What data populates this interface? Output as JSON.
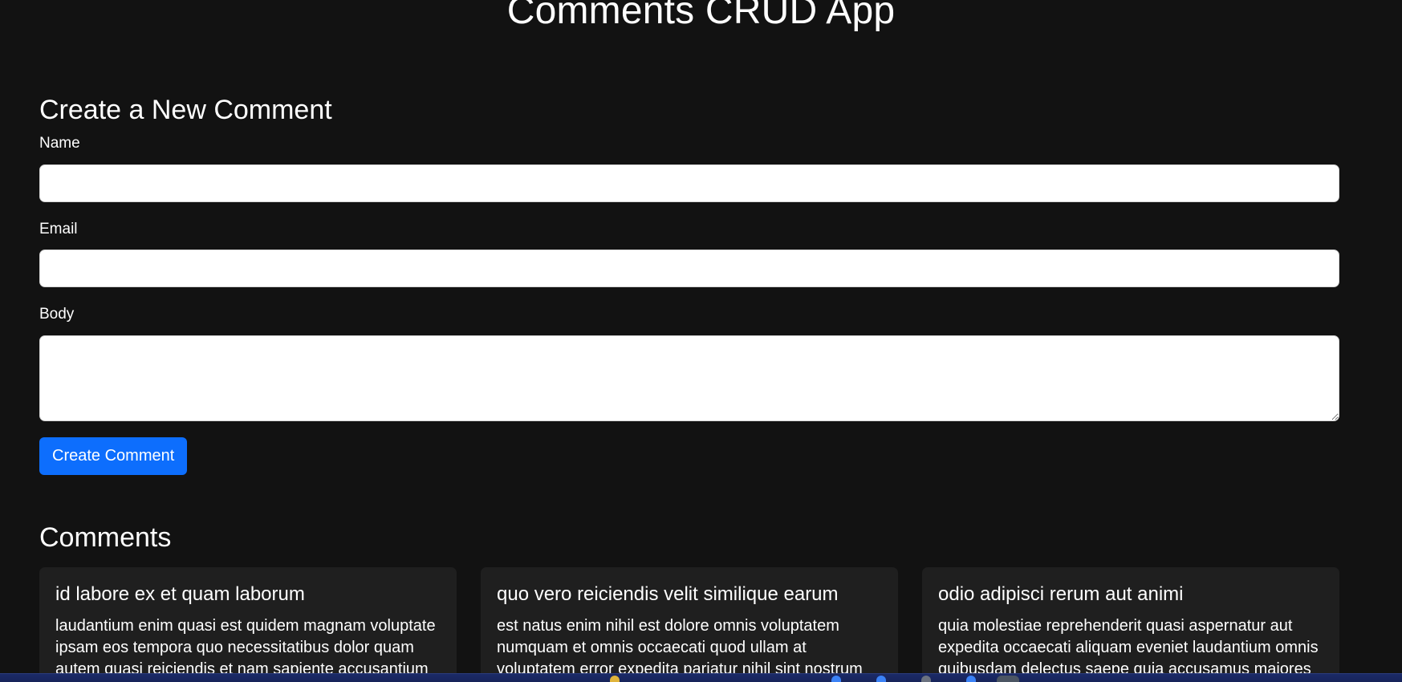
{
  "header": {
    "title": "Comments CRUD App"
  },
  "form": {
    "title": "Create a New Comment",
    "name_label": "Name",
    "name_value": "",
    "email_label": "Email",
    "email_value": "",
    "body_label": "Body",
    "body_value": "",
    "submit_label": "Create Comment"
  },
  "comments": {
    "title": "Comments",
    "items": [
      {
        "name": "id labore ex et quam laborum",
        "body": "laudantium enim quasi est quidem magnam voluptate ipsam eos tempora quo necessitatibus dolor quam autem quasi reiciendis et nam sapiente accusantium"
      },
      {
        "name": "quo vero reiciendis velit similique earum",
        "body": "est natus enim nihil est dolore omnis voluptatem numquam et omnis occaecati quod ullam at voluptatem error expedita pariatur nihil sint nostrum"
      },
      {
        "name": "odio adipisci rerum aut animi",
        "body": "quia molestiae reprehenderit quasi aspernatur aut expedita occaecati aliquam eveniet laudantium omnis quibusdam delectus saepe quia accusamus maiores nam"
      }
    ]
  },
  "colors": {
    "page_background": "#121212",
    "card_background": "#1f1f1f",
    "primary_button": "#0d6efd",
    "input_background": "#ffffff",
    "taskbar": "#1b2a67"
  }
}
